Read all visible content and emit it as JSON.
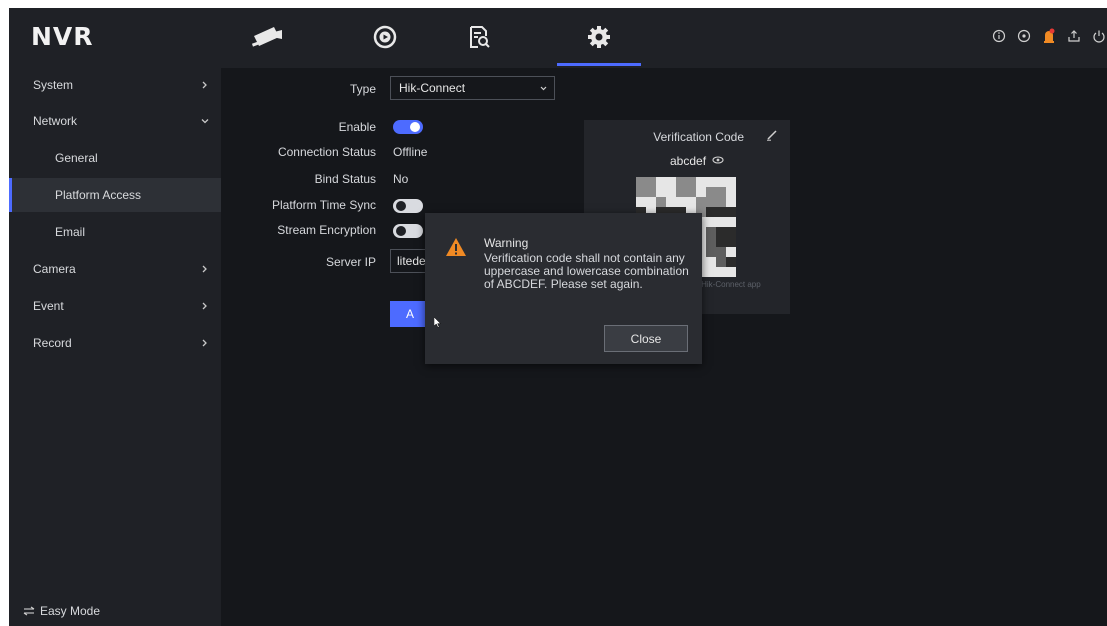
{
  "app": {
    "brand": "NVR"
  },
  "topbar": {
    "tabs": [
      {
        "icon": "camera-icon"
      },
      {
        "icon": "playback-icon"
      },
      {
        "icon": "file-search-icon"
      },
      {
        "icon": "gear-icon",
        "active": true
      }
    ],
    "status_icons": [
      "info-icon",
      "clock-icon",
      "alarm-icon",
      "export-icon",
      "power-icon"
    ]
  },
  "sidebar": {
    "items": [
      {
        "label": "System",
        "has_arrow": true
      },
      {
        "label": "Network",
        "expanded": true
      },
      {
        "label": "General"
      },
      {
        "label": "Platform Access",
        "selected": true
      },
      {
        "label": "Email"
      },
      {
        "label": "Camera",
        "has_arrow": true
      },
      {
        "label": "Event",
        "has_arrow": true
      },
      {
        "label": "Record",
        "has_arrow": true
      }
    ],
    "easy_mode": "Easy Mode"
  },
  "form": {
    "type_label": "Type",
    "type_value": "Hik-Connect",
    "enable_label": "Enable",
    "enable_on": true,
    "connection_status_label": "Connection Status",
    "connection_status_value": "Offline",
    "bind_status_label": "Bind Status",
    "bind_status_value": "No",
    "platform_time_sync_label": "Platform Time Sync",
    "platform_time_sync_on": false,
    "stream_encryption_label": "Stream Encryption",
    "stream_encryption_on": false,
    "server_ip_label": "Server IP",
    "server_ip_value": "litedev",
    "apply_label": "A"
  },
  "verification": {
    "title": "Verification Code",
    "code": "abcdef",
    "note": "ad Hik-Connect app"
  },
  "dialog": {
    "title": "Warning",
    "message": "Verification code shall not contain any uppercase and lowercase combination of ABCDEF. Please set again.",
    "close_label": "Close"
  },
  "colors": {
    "accent": "#4d6bff",
    "background": "#15171b",
    "panel": "#1f2126",
    "warning": "#f08a24"
  }
}
